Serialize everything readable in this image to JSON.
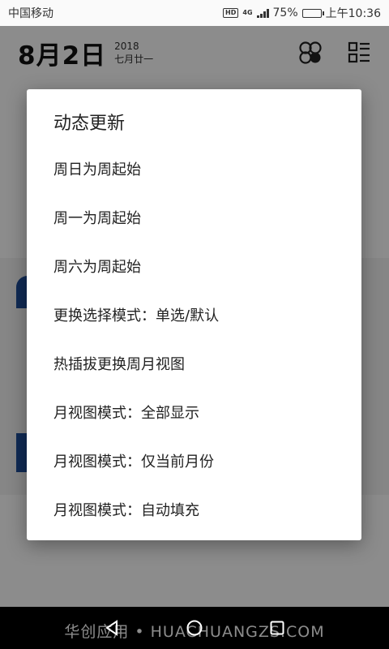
{
  "status_bar": {
    "carrier": "中国移动",
    "hd": "HD",
    "network": "4G",
    "battery_percent": "75%",
    "battery_level": 0.75,
    "time": "上午10:36"
  },
  "header": {
    "date": "8月2日",
    "year": "2018",
    "lunar": "七月廿一"
  },
  "dialog": {
    "title": "动态更新",
    "items": [
      "周日为周起始",
      "周一为周起始",
      "周六为周起始",
      "更换选择模式：单选/默认",
      "热插拔更换周月视图",
      "月视图模式：全部显示",
      "月视图模式：仅当前月份",
      "月视图模式：自动填充"
    ]
  },
  "watermark": "华创应用 • HUACHUANGZS.COM"
}
